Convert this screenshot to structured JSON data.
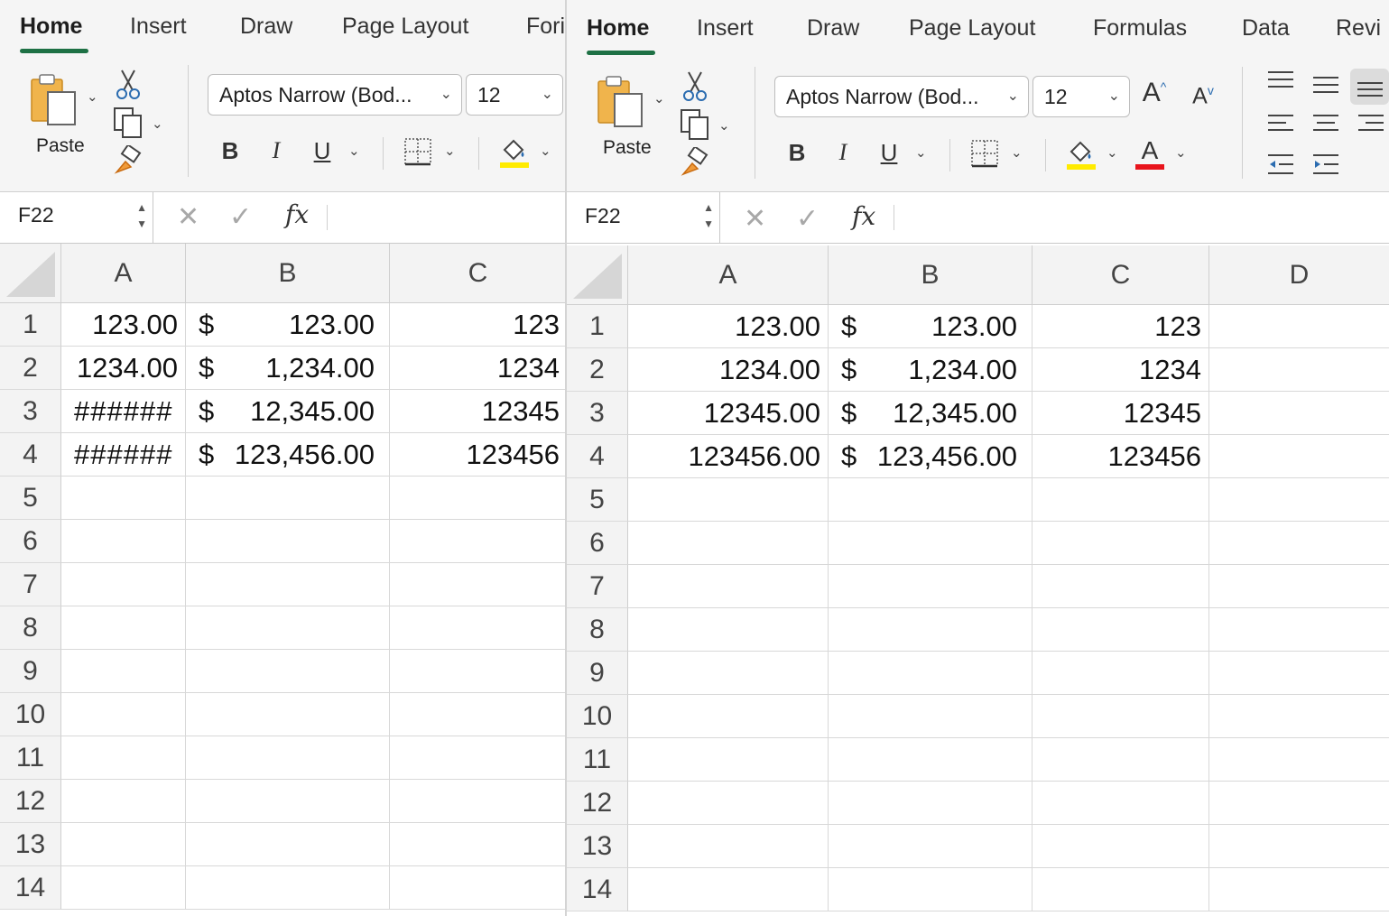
{
  "windows": [
    {
      "id": "left",
      "tabs": [
        "Home",
        "Insert",
        "Draw",
        "Page Layout",
        "Fori"
      ],
      "active_tab": "Home",
      "paste_label": "Paste",
      "font_name": "Aptos Narrow (Bod...",
      "font_size": "12",
      "format_buttons": {
        "bold": "B",
        "italic": "I",
        "underline": "U"
      },
      "name_box": "F22",
      "fx_label": "fx",
      "columns": [
        "A",
        "B",
        "C"
      ],
      "rows": [
        "1",
        "2",
        "3",
        "4",
        "5",
        "6",
        "7",
        "8",
        "9",
        "10",
        "11",
        "12",
        "13",
        "14"
      ],
      "data": [
        {
          "a": "123.00",
          "b_cur": "$",
          "b_val": "123.00",
          "c": "123"
        },
        {
          "a": "1234.00",
          "b_cur": "$",
          "b_val": "1,234.00",
          "c": "1234"
        },
        {
          "a": "######",
          "b_cur": "$",
          "b_val": "12,345.00",
          "c": "12345"
        },
        {
          "a": "######",
          "b_cur": "$",
          "b_val": "123,456.00",
          "c": "123456"
        }
      ]
    },
    {
      "id": "right",
      "tabs": [
        "Home",
        "Insert",
        "Draw",
        "Page Layout",
        "Formulas",
        "Data",
        "Revi"
      ],
      "active_tab": "Home",
      "paste_label": "Paste",
      "font_name": "Aptos Narrow (Bod...",
      "font_size": "12",
      "format_buttons": {
        "bold": "B",
        "italic": "I",
        "underline": "U"
      },
      "name_box": "F22",
      "fx_label": "fx",
      "columns": [
        "A",
        "B",
        "C",
        "D"
      ],
      "rows": [
        "1",
        "2",
        "3",
        "4",
        "5",
        "6",
        "7",
        "8",
        "9",
        "10",
        "11",
        "12",
        "13",
        "14"
      ],
      "data": [
        {
          "a": "123.00",
          "b_cur": "$",
          "b_val": "123.00",
          "c": "123"
        },
        {
          "a": "1234.00",
          "b_cur": "$",
          "b_val": "1,234.00",
          "c": "1234"
        },
        {
          "a": "12345.00",
          "b_cur": "$",
          "b_val": "12,345.00",
          "c": "12345"
        },
        {
          "a": "123456.00",
          "b_cur": "$",
          "b_val": "123,456.00",
          "c": "123456"
        }
      ]
    }
  ],
  "colors": {
    "accent_tab_underline": "#1e7145",
    "highlight_yellow": "#ffeb00",
    "font_red": "#e8141c",
    "ribbon_bg": "#f5f5f5",
    "header_bg": "#f3f3f3"
  },
  "icons": {
    "paste": "clipboard-icon",
    "cut": "scissors-icon",
    "copy": "copy-icon",
    "format_painter": "brush-icon",
    "borders": "borders-icon",
    "fill": "fill-bucket-icon",
    "font_color": "font-color-icon",
    "cancel": "cancel-x-icon",
    "enter": "checkmark-icon"
  },
  "right_extra": {
    "grow_font": "A",
    "shrink_font": "A",
    "font_color_letter": "A"
  }
}
